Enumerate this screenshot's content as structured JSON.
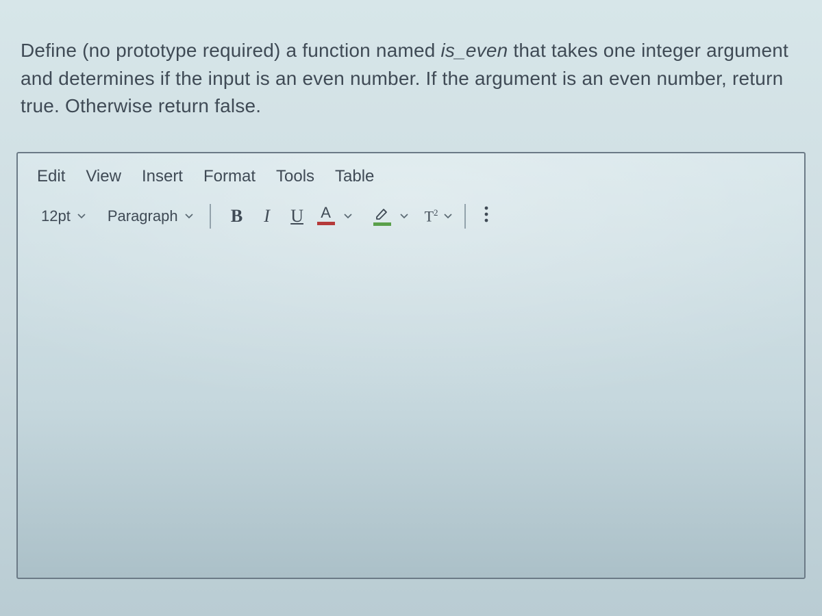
{
  "prompt": {
    "pre_italic": "Define (no prototype required) a function named ",
    "italic": "is_even",
    "post_italic": " that takes one integer argument and determines if the input is an even number. If the argument is an even number, return true. Otherwise return false."
  },
  "menu": {
    "edit": "Edit",
    "view": "View",
    "insert": "Insert",
    "format": "Format",
    "tools": "Tools",
    "table": "Table"
  },
  "toolbar": {
    "font_size": "12pt",
    "paragraph": "Paragraph",
    "bold_glyph": "B",
    "italic_glyph": "I",
    "underline_glyph": "U",
    "text_color_glyph": "A",
    "superscript_glyph_base": "T",
    "superscript_glyph_exp": "2",
    "text_color_swatch": "#b53a3a",
    "highlight_swatch": "#5aa04a"
  }
}
